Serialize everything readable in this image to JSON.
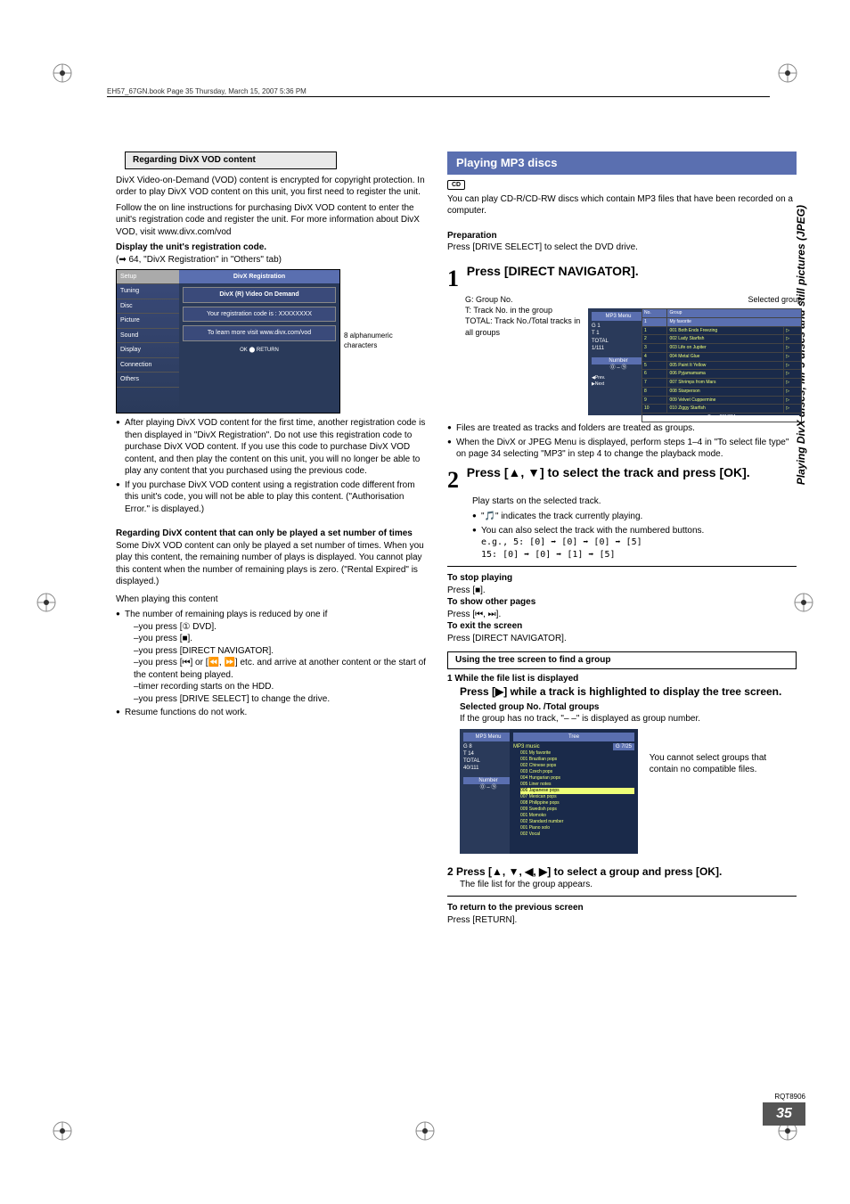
{
  "header_line": "EH57_67GN.book  Page 35  Thursday, March 15, 2007  5:36 PM",
  "side_label": "Playing DivX discs, MP3 discs and still pictures (JPEG)",
  "page_number": "35",
  "rqt": "RQT8906",
  "left": {
    "box1": "Regarding DivX VOD content",
    "p1": "DivX Video-on-Demand (VOD) content is encrypted for copyright protection. In order to play DivX VOD content on this unit, you first need to register the unit.",
    "p2": "Follow the on line instructions for purchasing DivX VOD content to enter the unit's registration code and register the unit. For more information about DivX VOD, visit www.divx.com/vod",
    "h1": "Display the unit's registration code.",
    "ref1": "(➡ 64, \"DivX Registration\" in \"Others\" tab)",
    "setup": {
      "side": [
        "Setup",
        "Tuning",
        "Disc",
        "Picture",
        "Sound",
        "Display",
        "Connection",
        "Others"
      ],
      "hdr": "DivX Registration",
      "sub1": "DivX (R) Video On Demand",
      "sub2": "Your registration code is : XXXXXXXX",
      "sub3": "To learn more visit www.divx.com/vod",
      "note": "8 alphanumeric characters"
    },
    "bul1": [
      "After playing DivX VOD content for the first time, another registration code is then displayed in \"DivX Registration\". Do not use this registration code to purchase DivX VOD content. If you use this code to purchase DivX VOD content, and then play the content on this unit, you will no longer be able to play any content that you purchased using the previous code.",
      "If you purchase DivX VOD content using a registration code different from this unit's code, you will not be able to play this content. (\"Authorisation Error.\" is displayed.)"
    ],
    "h2": "Regarding DivX content that can only be played a set number of times",
    "p3": "Some DivX VOD content can only be played a set number of times. When you play this content, the remaining number of plays is displayed. You cannot play this content when the number of remaining plays is zero. (\"Rental Expired\" is displayed.)",
    "p4": "When playing this content",
    "bul2a": "The number of remaining plays is reduced by one if",
    "dash": [
      "–you press [① DVD].",
      "–you press [■].",
      "–you press [DIRECT NAVIGATOR].",
      "–you press [⏮] or [⏪, ⏩] etc. and arrive at another content or the start of the content being played.",
      "–timer recording starts on the HDD.",
      "–you press [DRIVE SELECT] to change the drive."
    ],
    "bul2b": "Resume functions do not work."
  },
  "right": {
    "band": "Playing MP3 discs",
    "badge": "CD",
    "p1": "You can play CD-R/CD-RW discs which contain MP3 files that have been recorded on a computer.",
    "prep_h": "Preparation",
    "prep_t": "Press [DRIVE SELECT] to select the DVD drive.",
    "step1": "Press [DIRECT NAVIGATOR].",
    "selected_group": "Selected group",
    "legend": {
      "g": "G:  Group No.",
      "t": "T:  Track No. in the group",
      "total": "TOTAL: Track No./Total tracks in all groups"
    },
    "tracks": [
      [
        "1",
        "001 Both Ends Freezing"
      ],
      [
        "2",
        "002 Lady Starfish"
      ],
      [
        "3",
        "003 Life on Jupiter"
      ],
      [
        "4",
        "004 Metal Glue"
      ],
      [
        "5",
        "005 Paint It Yellow"
      ],
      [
        "6",
        "006 Pyjamamama"
      ],
      [
        "7",
        "007 Shrimps from Mars"
      ],
      [
        "8",
        "008 Starperson"
      ],
      [
        "9",
        "009 Velvet Cuppermine"
      ],
      [
        "10",
        "010 Ziggy Starfish"
      ]
    ],
    "track_footer": "Page 001/024",
    "track_group": "My favorite",
    "bul": [
      "Files are treated as tracks and folders are treated as groups.",
      "When the DivX or JPEG Menu is displayed, perform steps 1–4 in \"To select file type\" on page 34 selecting \"MP3\" in step 4 to change the playback mode."
    ],
    "step2": "Press [▲, ▼] to select the track and press [OK].",
    "s2_a": "Play starts on the selected track.",
    "s2_b": "\"🎵\" indicates the track currently playing.",
    "s2_c": "You can also select the track with the numbered buttons.",
    "eg1": "e.g.,     5:       [0] ➡ [0] ➡ [0] ➡ [5]",
    "eg2": "           15:     [0] ➡ [0] ➡ [1] ➡ [5]",
    "stop_h": "To stop playing",
    "stop_t": "Press [■].",
    "pages_h": "To show other pages",
    "pages_t": "Press [⏮, ⏭].",
    "exit_h": "To exit the screen",
    "exit_t": "Press [DIRECT NAVIGATOR].",
    "tree_box": "Using the tree screen to find a group",
    "t1_h": "1   While the file list is displayed",
    "t1_s": "Press [▶] while a track is highlighted to display the tree screen.",
    "t1_sel": "Selected group No. /Total groups",
    "t1_note": "If the group has no track, \"– –\" is displayed as group number.",
    "tree": {
      "hdr": "Tree",
      "root": "MP3 music",
      "badge": "G   7/25",
      "items": [
        "001 My favorite",
        "001 Brazilian pops",
        "002 Chinese pops",
        "003 Czech pops",
        "004 Hungarian pops",
        "005 Liner notes",
        "006 Japanese pops",
        "007 Mexican pops",
        "008 Philippine pops",
        "009 Swedish pops",
        "001 Momoko",
        "002 Standard number",
        "001 Piano solo",
        "002 Vocal"
      ]
    },
    "tree_note": "You cannot select groups that contain no compatible files.",
    "t2": "2  Press [▲, ▼, ◀, ▶] to select a group and press [OK].",
    "t2_t": "The file list for the group appears.",
    "ret_h": "To return to the previous screen",
    "ret_t": "Press [RETURN]."
  }
}
